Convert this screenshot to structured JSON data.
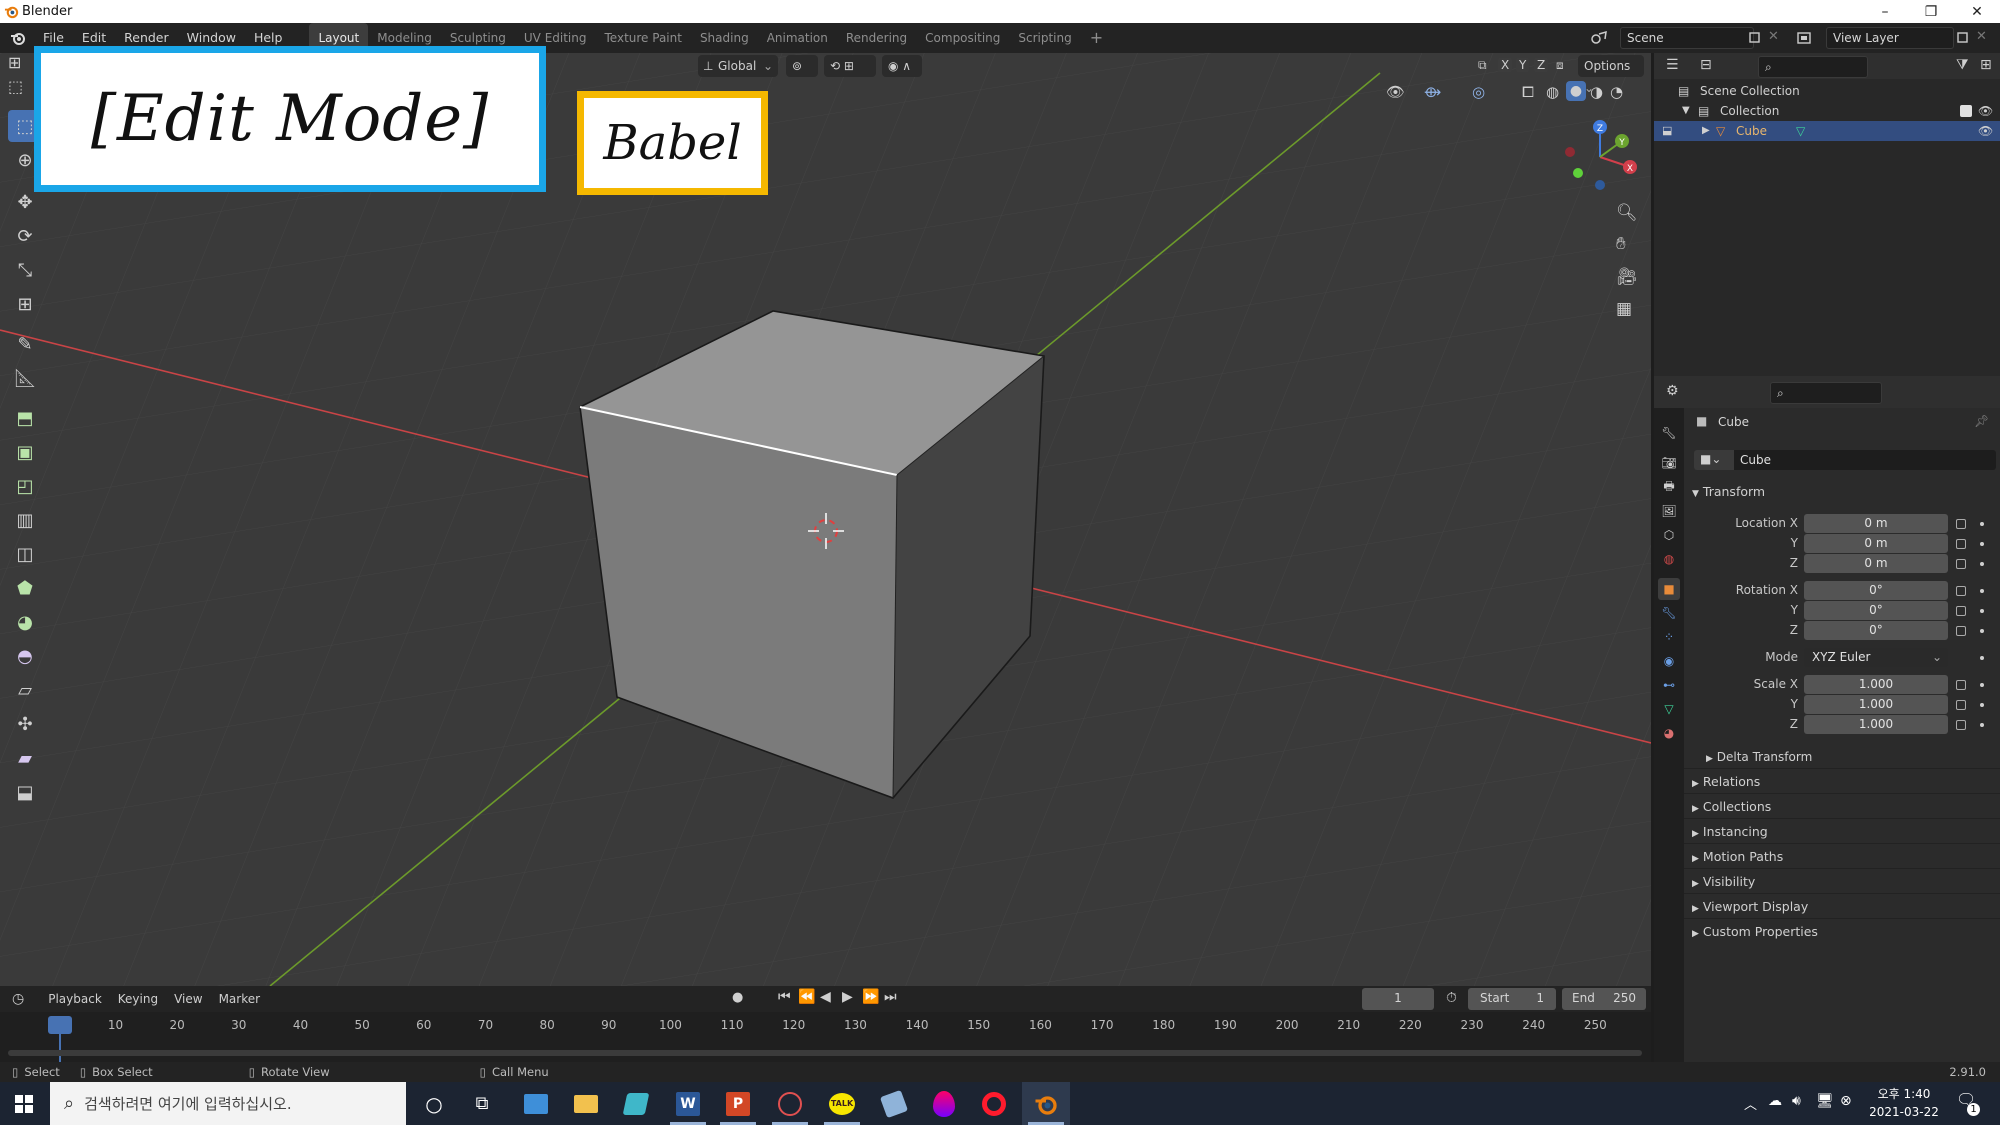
{
  "window": {
    "title": "Blender",
    "minimize": "–",
    "restore": "❐",
    "close": "✕"
  },
  "menus": [
    "File",
    "Edit",
    "Render",
    "Window",
    "Help"
  ],
  "workspaces": [
    "Layout",
    "Modeling",
    "Sculpting",
    "UV Editing",
    "Texture Paint",
    "Shading",
    "Animation",
    "Rendering",
    "Compositing",
    "Scripting"
  ],
  "workspace_add": "+",
  "scene_name": "Scene",
  "view_layer": "View Layer",
  "viewport_header": {
    "orientation": "Global",
    "axes": [
      "X",
      "Y",
      "Z"
    ],
    "options": "Options"
  },
  "overlay_labels": {
    "edit_mode": "[Edit Mode]",
    "babel": "Babel"
  },
  "gizmo": {
    "x": "X",
    "y": "Y",
    "z": "Z"
  },
  "outliner": {
    "root": "Scene Collection",
    "collection": "Collection",
    "object": "Cube"
  },
  "properties": {
    "object_name_header": "Cube",
    "object_name_field": "Cube",
    "transform_title": "Transform",
    "location": {
      "label": "Location X",
      "x": "0 m",
      "y": "0 m",
      "z": "0 m"
    },
    "rotation": {
      "label": "Rotation X",
      "x": "0°",
      "y": "0°",
      "z": "0°"
    },
    "axis_y": "Y",
    "axis_z": "Z",
    "mode_label": "Mode",
    "mode_value": "XYZ Euler",
    "scale": {
      "label": "Scale X",
      "x": "1.000",
      "y": "1.000",
      "z": "1.000"
    },
    "delta_transform": "Delta Transform",
    "sections": [
      "Relations",
      "Collections",
      "Instancing",
      "Motion Paths",
      "Visibility",
      "Viewport Display",
      "Custom Properties"
    ]
  },
  "timeline": {
    "menus": [
      "Playback",
      "Keying",
      "View",
      "Marker"
    ],
    "current_frame": "1",
    "start_label": "Start",
    "start_value": "1",
    "end_label": "End",
    "end_value": "250",
    "ticks": [
      "1",
      "10",
      "20",
      "30",
      "40",
      "50",
      "60",
      "70",
      "80",
      "90",
      "100",
      "110",
      "120",
      "130",
      "140",
      "150",
      "160",
      "170",
      "180",
      "190",
      "200",
      "210",
      "220",
      "230",
      "240",
      "250"
    ]
  },
  "statusbar": {
    "select": "Select",
    "box_select": "Box Select",
    "rotate_view": "Rotate View",
    "call_menu": "Call Menu",
    "version": "2.91.0"
  },
  "taskbar": {
    "search_placeholder": "검색하려면 여기에 입력하십시오.",
    "time": "오후 1:40",
    "date": "2021-03-22",
    "notification_count": "1"
  },
  "colors": {
    "accent_blue": "#4772b3",
    "x_axis_red": "#c94446",
    "y_axis_green": "#6c9a2b",
    "edit_label_border": "#1aa6e8",
    "babel_label_border": "#f5b800",
    "object_orange": "#e88b3a"
  }
}
